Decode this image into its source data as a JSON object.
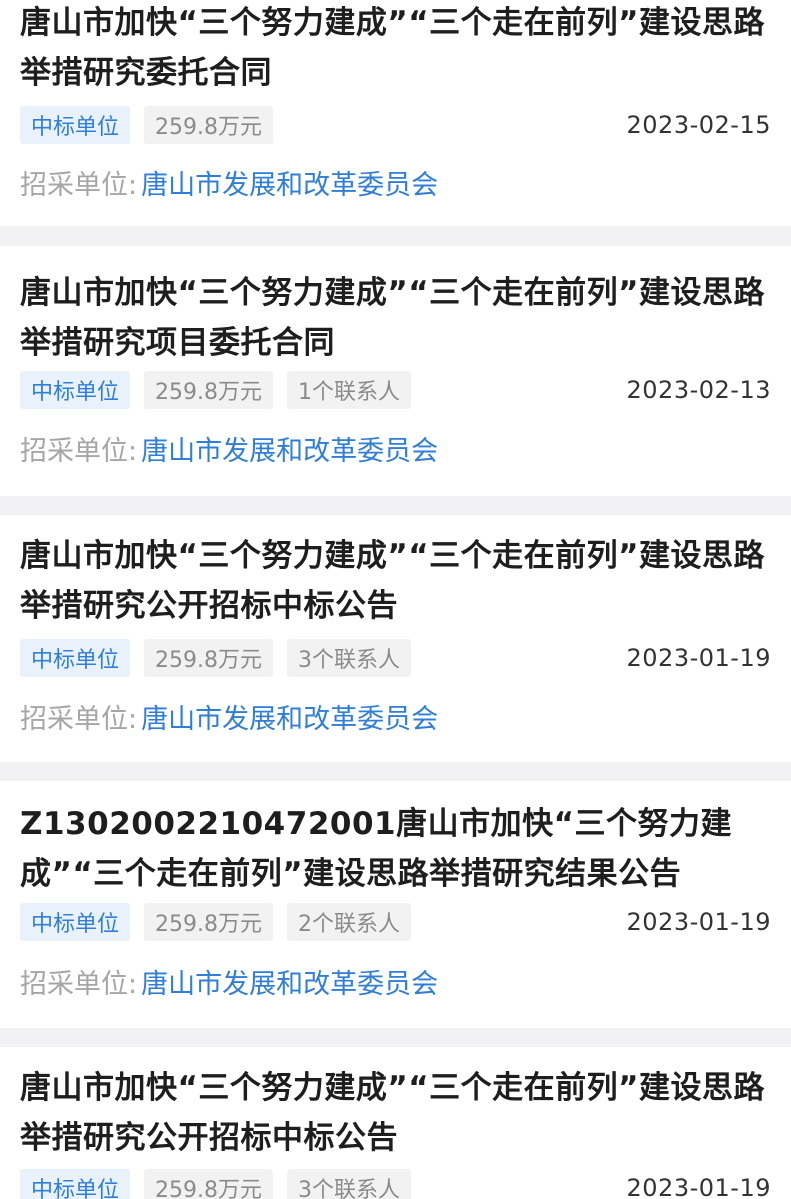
{
  "items": [
    {
      "title": "唐山市加快“三个努力建成”“三个走在前列”建设思路举措研究委托合同",
      "tags": [
        "中标单位",
        "259.8万元"
      ],
      "date": "2023-02-15",
      "buyer_label": "招采单位:",
      "buyer_name": "唐山市发展和改革委员会"
    },
    {
      "title": "唐山市加快“三个努力建成”“三个走在前列”建设思路举措研究项目委托合同",
      "tags": [
        "中标单位",
        "259.8万元",
        "1个联系人"
      ],
      "date": "2023-02-13",
      "buyer_label": "招采单位:",
      "buyer_name": "唐山市发展和改革委员会"
    },
    {
      "title": "唐山市加快“三个努力建成”“三个走在前列”建设思路举措研究公开招标中标公告",
      "tags": [
        "中标单位",
        "259.8万元",
        "3个联系人"
      ],
      "date": "2023-01-19",
      "buyer_label": "招采单位:",
      "buyer_name": "唐山市发展和改革委员会"
    },
    {
      "title": "Z1302002210472001唐山市加快“三个努力建成”“三个走在前列”建设思路举措研究结果公告",
      "tags": [
        "中标单位",
        "259.8万元",
        "2个联系人"
      ],
      "date": "2023-01-19",
      "buyer_label": "招采单位:",
      "buyer_name": "唐山市发展和改革委员会"
    },
    {
      "title": "唐山市加快“三个努力建成”“三个走在前列”建设思路举措研究公开招标中标公告",
      "tags": [
        "中标单位",
        "259.8万元",
        "3个联系人"
      ],
      "date": "2023-01-19",
      "buyer_label": "",
      "buyer_name": ""
    }
  ],
  "colors": {
    "accent": "#2f7ed8",
    "tag_blue_bg": "#e9f1fb",
    "tag_gray_bg": "#f2f2f2",
    "separator": "#f2f2f4"
  }
}
